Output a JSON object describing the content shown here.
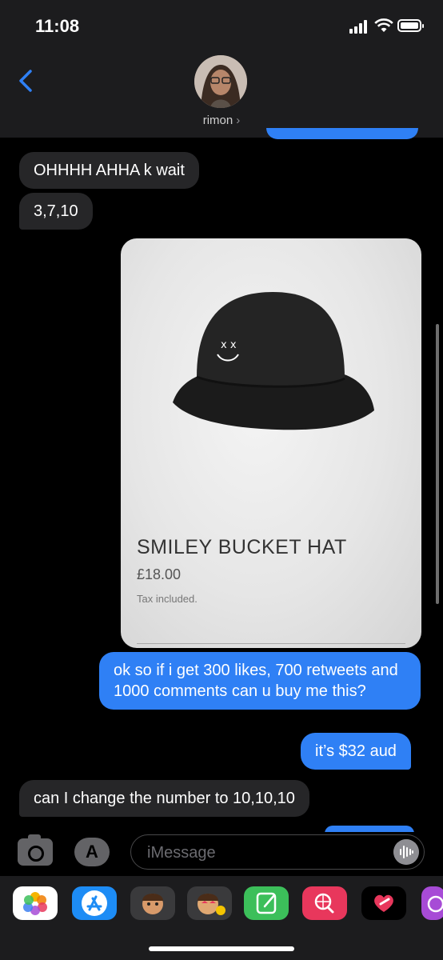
{
  "status": {
    "time": "11:08"
  },
  "contact": {
    "name": "rimon",
    "chevron": "›"
  },
  "messages": [
    {
      "side": "received",
      "text": "OHHHH AHHA k wait"
    },
    {
      "side": "received",
      "text": "3,7,10"
    },
    {
      "side": "sent",
      "text": "ok so if i get 300 likes, 700 retweets and 1000 comments can u buy me this?"
    },
    {
      "side": "sent",
      "text": "it’s $32 aud"
    },
    {
      "side": "received",
      "text": "can I change the number to 10,10,10"
    }
  ],
  "product_card": {
    "title": "SMILEY BUCKET HAT",
    "price": "£18.00",
    "tax_note": "Tax included."
  },
  "input": {
    "placeholder": "iMessage"
  },
  "apps_button_label": "A",
  "app_drawer": [
    "photos-app-icon",
    "app-store-icon",
    "memoji-icon",
    "memoji-stickers-icon",
    "notes-app-icon",
    "web-search-icon",
    "digital-touch-icon",
    "music-app-icon"
  ],
  "colors": {
    "sent_bubble": "#2f80f5",
    "received_bubble": "#262628",
    "background": "#000000"
  }
}
